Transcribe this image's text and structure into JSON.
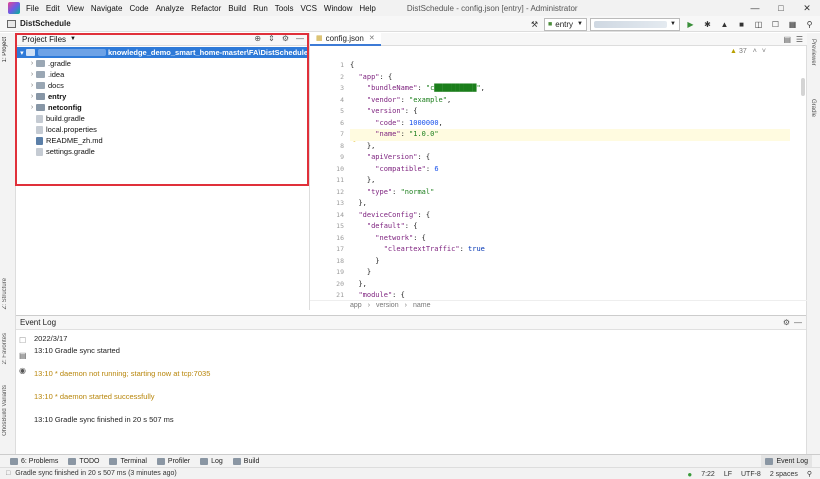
{
  "menubar": {
    "items": [
      "File",
      "Edit",
      "View",
      "Navigate",
      "Code",
      "Analyze",
      "Refactor",
      "Build",
      "Run",
      "Tools",
      "VCS",
      "Window",
      "Help"
    ],
    "title": "DistSchedule - config.json [entry] - Administrator"
  },
  "toolbar": {
    "project_name": "DistSchedule",
    "run_config": "entry",
    "device": "■■■■■■■■■■"
  },
  "left_strip": {
    "tabs": [
      "1: Project",
      "Z: Structure",
      "2: Favorites",
      "OhosBuild Variants"
    ]
  },
  "right_strip": {
    "tabs": [
      "Previewer",
      "Gradle"
    ]
  },
  "project_panel": {
    "title": "Project Files",
    "root_path": "knowledge_demo_smart_home-master\\FA\\DistSchedule",
    "items": [
      {
        "label": ".gradle",
        "kind": "folder",
        "bold": false
      },
      {
        "label": ".idea",
        "kind": "folder",
        "bold": false
      },
      {
        "label": "docs",
        "kind": "folder",
        "bold": false
      },
      {
        "label": "entry",
        "kind": "module",
        "bold": true
      },
      {
        "label": "netconfig",
        "kind": "module",
        "bold": true
      },
      {
        "label": "build.gradle",
        "kind": "file",
        "bold": false
      },
      {
        "label": "local.properties",
        "kind": "file",
        "bold": false
      },
      {
        "label": "README_zh.md",
        "kind": "md",
        "bold": false
      },
      {
        "label": "settings.gradle",
        "kind": "file",
        "bold": false
      }
    ]
  },
  "editor": {
    "tab": "config.json",
    "warning_count": "37",
    "line_numbers": [
      "1",
      "2",
      "3",
      "4",
      "5",
      "6",
      "7",
      "8",
      "9",
      "10",
      "11",
      "12",
      "13",
      "14",
      "15",
      "16",
      "17",
      "18",
      "19",
      "20",
      "21"
    ],
    "lines": [
      "{",
      "  \"app\": {",
      "    \"bundleName\": \"c██████████\",",
      "    \"vendor\": \"example\",",
      "    \"version\": {",
      "      \"code\": 1000000,",
      "      \"name\": \"1.0.0\"",
      "    },",
      "    \"apiVersion\": {",
      "      \"compatible\": 6",
      "    },",
      "    \"type\": \"normal\"",
      "  },",
      "  \"deviceConfig\": {",
      "    \"default\": {",
      "      \"network\": {",
      "        \"cleartextTraffic\": true",
      "      }",
      "    }",
      "  },",
      "  \"module\": {"
    ],
    "breadcrumb": [
      "app",
      "version",
      "name"
    ]
  },
  "event_log": {
    "title": "Event Log",
    "lines": [
      {
        "text": "2022/3/17",
        "warn": false
      },
      {
        "text": "13:10  Gradle sync started",
        "warn": false
      },
      {
        "text": "",
        "warn": false
      },
      {
        "text": "13:10  * daemon not running; starting now at tcp:7035",
        "warn": true
      },
      {
        "text": "",
        "warn": false
      },
      {
        "text": "13:10  * daemon started successfully",
        "warn": true
      },
      {
        "text": "",
        "warn": false
      },
      {
        "text": "13:10  Gradle sync finished in 20 s 507 ms",
        "warn": false
      }
    ]
  },
  "tool_windows": [
    "6: Problems",
    "TODO",
    "Terminal",
    "Profiler",
    "Log",
    "Build"
  ],
  "tool_windows_right": "Event Log",
  "status": {
    "message": "Gradle sync finished in 20 s 507 ms (3 minutes ago)",
    "position": "7:22",
    "line_sep": "LF",
    "encoding": "UTF-8",
    "indent": "2 spaces"
  },
  "colors": {
    "selection": "#2e7ad8",
    "highlight_box": "#e0303a",
    "warning_text": "#b8860b"
  }
}
